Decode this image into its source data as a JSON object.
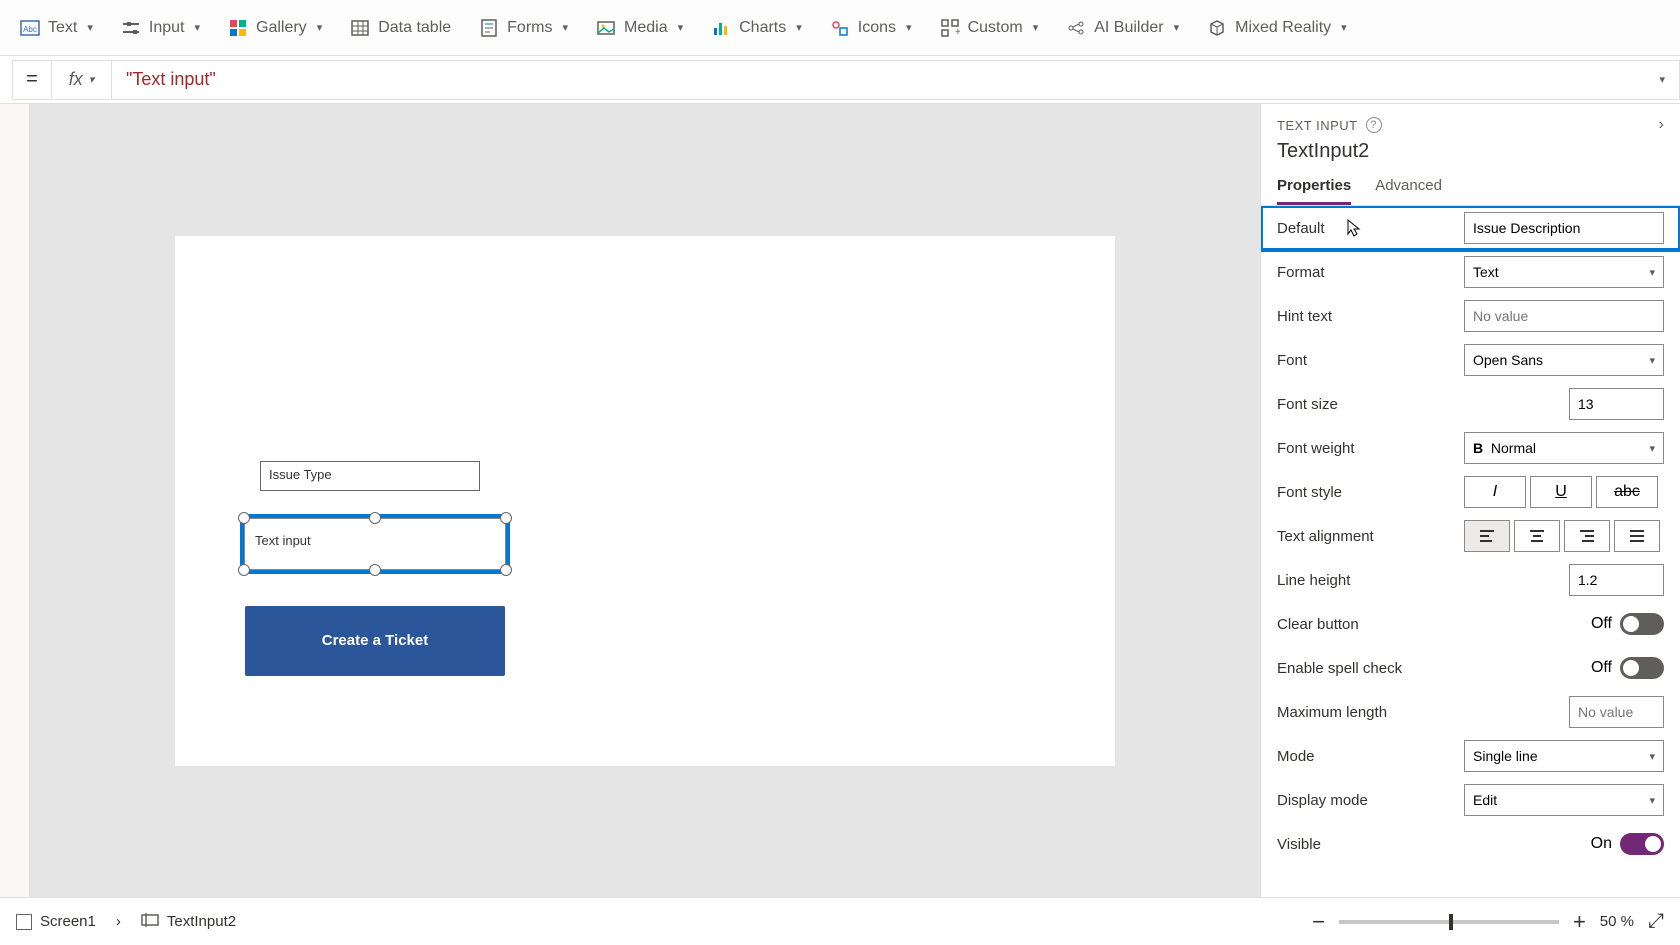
{
  "toolbar": {
    "items": [
      {
        "label": "Text"
      },
      {
        "label": "Input"
      },
      {
        "label": "Gallery"
      },
      {
        "label": "Data table"
      },
      {
        "label": "Forms"
      },
      {
        "label": "Media"
      },
      {
        "label": "Charts"
      },
      {
        "label": "Icons"
      },
      {
        "label": "Custom"
      },
      {
        "label": "AI Builder"
      },
      {
        "label": "Mixed Reality"
      }
    ]
  },
  "formula": {
    "equals": "=",
    "fx": "fx",
    "value": "\"Text input\""
  },
  "canvas": {
    "textInput1": "Issue Type",
    "textInput2": "Text input",
    "button": "Create a Ticket"
  },
  "props": {
    "typeLabel": "TEXT INPUT",
    "controlName": "TextInput2",
    "tabs": {
      "properties": "Properties",
      "advanced": "Advanced"
    },
    "rows": {
      "default": {
        "label": "Default",
        "value": "Issue Description"
      },
      "format": {
        "label": "Format",
        "value": "Text"
      },
      "hintText": {
        "label": "Hint text",
        "placeholder": "No value"
      },
      "font": {
        "label": "Font",
        "value": "Open Sans"
      },
      "fontSize": {
        "label": "Font size",
        "value": "13"
      },
      "fontWeight": {
        "label": "Font weight",
        "value": "Normal"
      },
      "fontStyle": {
        "label": "Font style"
      },
      "textAlignment": {
        "label": "Text alignment"
      },
      "lineHeight": {
        "label": "Line height",
        "value": "1.2"
      },
      "clearButton": {
        "label": "Clear button",
        "value": "Off"
      },
      "enableSpellCheck": {
        "label": "Enable spell check",
        "value": "Off"
      },
      "maximumLength": {
        "label": "Maximum length",
        "placeholder": "No value"
      },
      "mode": {
        "label": "Mode",
        "value": "Single line"
      },
      "displayMode": {
        "label": "Display mode",
        "value": "Edit"
      },
      "visible": {
        "label": "Visible",
        "value": "On"
      }
    }
  },
  "statusBar": {
    "screen": "Screen1",
    "control": "TextInput2",
    "zoom": "50 %"
  }
}
